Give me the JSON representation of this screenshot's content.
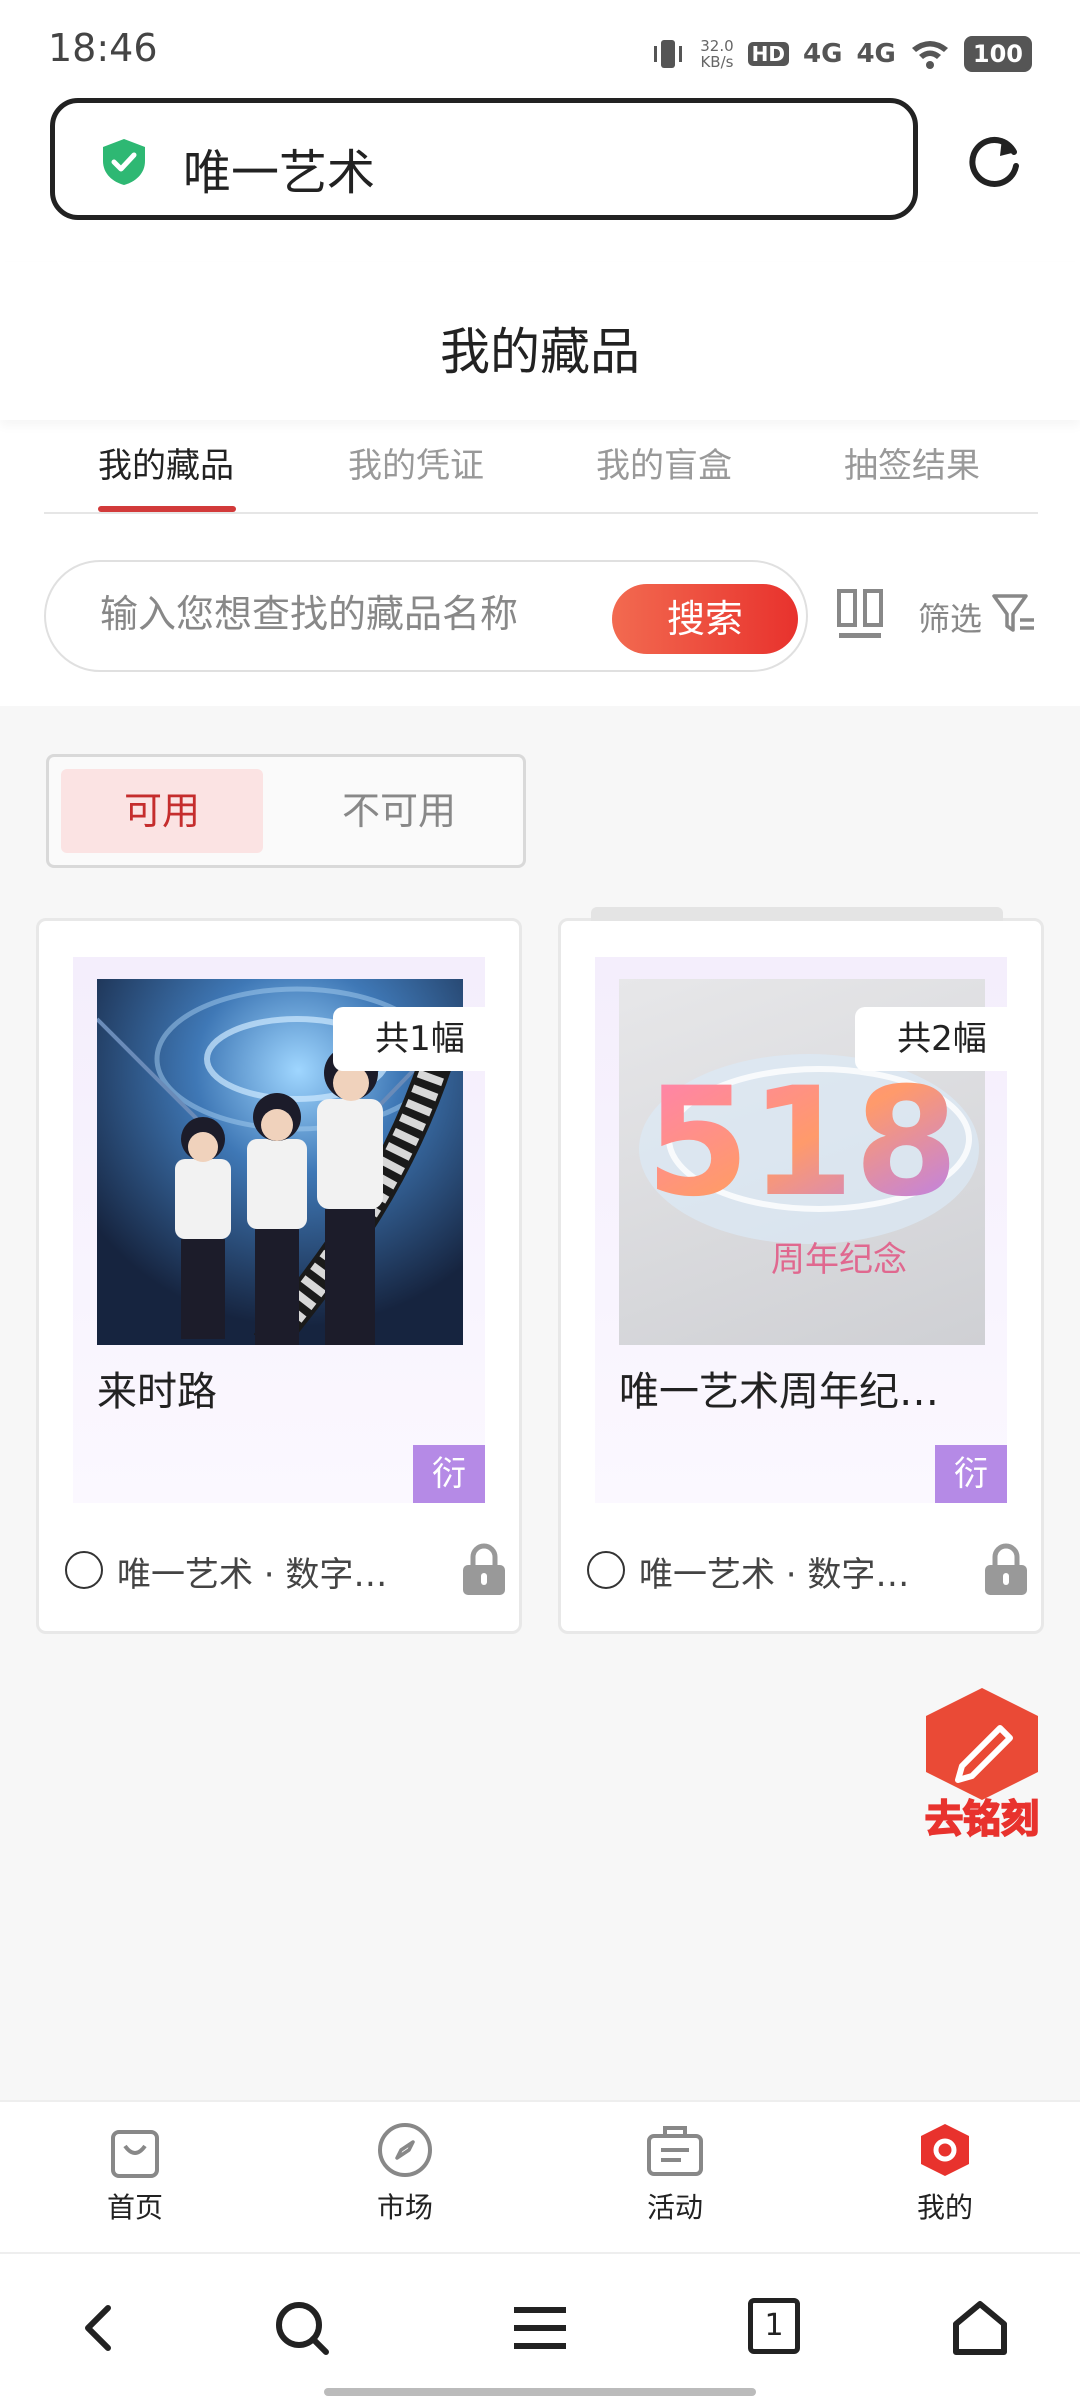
{
  "status_bar": {
    "time": "18:46",
    "net_speed_value": "32.0",
    "net_speed_unit": "KB/s",
    "hd": "HD",
    "sig1": "4G",
    "sig2": "4G",
    "battery": "100"
  },
  "browser": {
    "url_text": "唯一艺术"
  },
  "page": {
    "title": "我的藏品"
  },
  "tabs": [
    {
      "label": "我的藏品",
      "active": true
    },
    {
      "label": "我的凭证",
      "active": false
    },
    {
      "label": "我的盲盒",
      "active": false
    },
    {
      "label": "抽签结果",
      "active": false
    }
  ],
  "search": {
    "placeholder": "输入您想查找的藏品名称",
    "button_label": "搜索",
    "filter_label": "筛选"
  },
  "availability": {
    "available": "可用",
    "unavailable": "不可用"
  },
  "cards": [
    {
      "count": "共1幅",
      "name": "来时路",
      "tag": "衍",
      "issuer": "唯一艺术 · 数字…"
    },
    {
      "count": "共2幅",
      "name": "唯一艺术周年纪…",
      "tag": "衍",
      "issuer": "唯一艺术 · 数字…",
      "img_big_text": "518",
      "img_small_text": "周年纪念"
    }
  ],
  "engrave_button": "去铭刻",
  "bottom_nav": [
    {
      "label": "首页",
      "icon": "bag-icon"
    },
    {
      "label": "市场",
      "icon": "compass-icon"
    },
    {
      "label": "活动",
      "icon": "briefcase-icon"
    },
    {
      "label": "我的",
      "icon": "profile-hexagon-icon"
    }
  ],
  "system_nav": {
    "tab_count": "1"
  },
  "colors": {
    "accent": "#e8322d",
    "tag_purple": "#b58ae6",
    "shield_green": "#2eb873"
  }
}
